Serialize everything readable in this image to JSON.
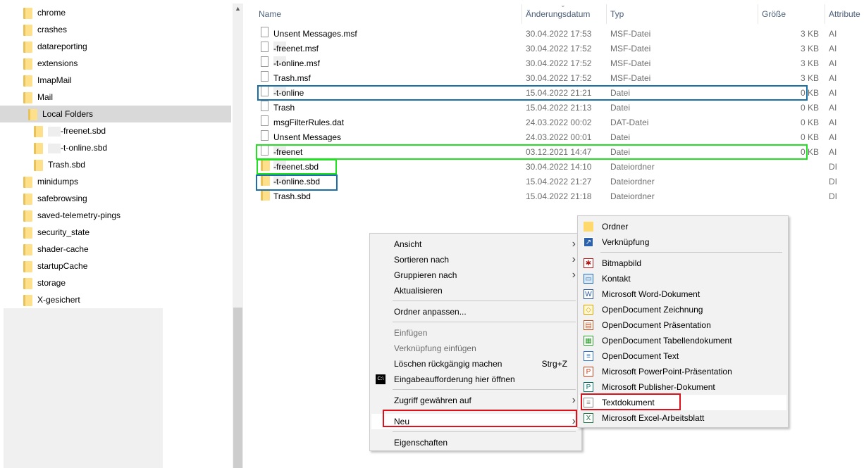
{
  "nav": {
    "items": [
      {
        "label": "chrome",
        "level": 0
      },
      {
        "label": "crashes",
        "level": 0
      },
      {
        "label": "datareporting",
        "level": 0
      },
      {
        "label": "extensions",
        "level": 0
      },
      {
        "label": "ImapMail",
        "level": 0
      },
      {
        "label": "Mail",
        "level": 0
      },
      {
        "label": "Local Folders",
        "level": 1,
        "selected": true
      },
      {
        "label": "-freenet.sbd",
        "level": 2,
        "redacted": true
      },
      {
        "label": "-t-online.sbd",
        "level": 2,
        "redacted": true
      },
      {
        "label": "Trash.sbd",
        "level": 2
      },
      {
        "label": "minidumps",
        "level": 0
      },
      {
        "label": "safebrowsing",
        "level": 0
      },
      {
        "label": "saved-telemetry-pings",
        "level": 0
      },
      {
        "label": "security_state",
        "level": 0
      },
      {
        "label": "shader-cache",
        "level": 0
      },
      {
        "label": "startupCache",
        "level": 0
      },
      {
        "label": "storage",
        "level": 0
      },
      {
        "label": "X-gesichert",
        "level": 0
      }
    ]
  },
  "list": {
    "headers": {
      "name": "Name",
      "date": "Änderungsdatum",
      "type": "Typ",
      "size": "Größe",
      "attr": "Attribute"
    },
    "rows": [
      {
        "name": "Unsent Messages.msf",
        "date": "30.04.2022 17:53",
        "type": "MSF-Datei",
        "size": "3 KB",
        "attr": "AI",
        "kind": "file"
      },
      {
        "name": "-freenet.msf",
        "date": "30.04.2022 17:52",
        "type": "MSF-Datei",
        "size": "3 KB",
        "attr": "AI",
        "kind": "file",
        "redacted": true
      },
      {
        "name": "-t-online.msf",
        "date": "30.04.2022 17:52",
        "type": "MSF-Datei",
        "size": "3 KB",
        "attr": "AI",
        "kind": "file",
        "redacted": true
      },
      {
        "name": "Trash.msf",
        "date": "30.04.2022 17:52",
        "type": "MSF-Datei",
        "size": "3 KB",
        "attr": "AI",
        "kind": "file"
      },
      {
        "name": "-t-online",
        "date": "15.04.2022 21:21",
        "type": "Datei",
        "size": "0 KB",
        "attr": "AI",
        "kind": "file",
        "redacted": true
      },
      {
        "name": "Trash",
        "date": "15.04.2022 21:13",
        "type": "Datei",
        "size": "0 KB",
        "attr": "AI",
        "kind": "file"
      },
      {
        "name": "msgFilterRules.dat",
        "date": "24.03.2022 00:02",
        "type": "DAT-Datei",
        "size": "0 KB",
        "attr": "AI",
        "kind": "file"
      },
      {
        "name": "Unsent Messages",
        "date": "24.03.2022 00:01",
        "type": "Datei",
        "size": "0 KB",
        "attr": "AI",
        "kind": "file"
      },
      {
        "name": "-freenet",
        "date": "03.12.2021 14:47",
        "type": "Datei",
        "size": "0 KB",
        "attr": "AI",
        "kind": "file",
        "redacted": true
      },
      {
        "name": "-freenet.sbd",
        "date": "30.04.2022 14:10",
        "type": "Dateiordner",
        "size": "",
        "attr": "DI",
        "kind": "folder",
        "redacted": true
      },
      {
        "name": "-t-online.sbd",
        "date": "15.04.2022 21:27",
        "type": "Dateiordner",
        "size": "",
        "attr": "DI",
        "kind": "folder",
        "redacted": true
      },
      {
        "name": "Trash.sbd",
        "date": "15.04.2022 21:18",
        "type": "Dateiordner",
        "size": "",
        "attr": "DI",
        "kind": "folder"
      }
    ]
  },
  "colors": {
    "blue_highlight": "#1a6fa8",
    "green_highlight": "#22e022",
    "red_highlight": "#e0101a"
  },
  "context_menu": {
    "items": [
      {
        "label": "Ansicht",
        "submenu": true
      },
      {
        "label": "Sortieren nach",
        "submenu": true
      },
      {
        "label": "Gruppieren nach",
        "submenu": true
      },
      {
        "label": "Aktualisieren"
      },
      {
        "sep": true
      },
      {
        "label": "Ordner anpassen..."
      },
      {
        "sep": true
      },
      {
        "label": "Einfügen",
        "disabled": true
      },
      {
        "label": "Verknüpfung einfügen",
        "disabled": true
      },
      {
        "label": "Löschen rückgängig machen",
        "shortcut": "Strg+Z"
      },
      {
        "label": "Eingabeaufforderung hier öffnen",
        "icon": "cmd"
      },
      {
        "sep": true
      },
      {
        "label": "Zugriff gewähren auf",
        "submenu": true
      },
      {
        "sep": true
      },
      {
        "label": "Neu",
        "submenu": true,
        "active": true
      },
      {
        "sep": true
      },
      {
        "label": "Eigenschaften"
      }
    ]
  },
  "new_submenu": {
    "items": [
      {
        "label": "Ordner",
        "icon": "folder"
      },
      {
        "label": "Verknüpfung",
        "icon": "shortcut"
      },
      {
        "sep": true
      },
      {
        "label": "Bitmapbild",
        "icon": "bitmap"
      },
      {
        "label": "Kontakt",
        "icon": "contact"
      },
      {
        "label": "Microsoft Word-Dokument",
        "icon": "word"
      },
      {
        "label": "OpenDocument Zeichnung",
        "icon": "odg"
      },
      {
        "label": "OpenDocument Präsentation",
        "icon": "odp"
      },
      {
        "label": "OpenDocument Tabellendokument",
        "icon": "ods"
      },
      {
        "label": "OpenDocument Text",
        "icon": "odt"
      },
      {
        "label": "Microsoft PowerPoint-Präsentation",
        "icon": "powerpoint"
      },
      {
        "label": "Microsoft Publisher-Dokument",
        "icon": "publisher"
      },
      {
        "label": "Textdokument",
        "icon": "text",
        "active": true
      },
      {
        "label": "Microsoft Excel-Arbeitsblatt",
        "icon": "excel"
      }
    ]
  }
}
